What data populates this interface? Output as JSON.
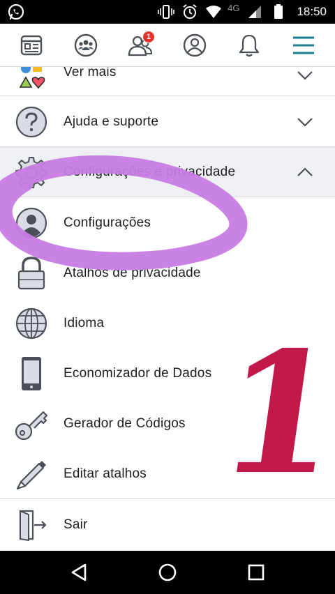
{
  "status_bar": {
    "network": "4G",
    "time": "18:50",
    "icons": [
      "whatsapp-icon",
      "vibrate-icon",
      "alarm-icon",
      "wifi-icon",
      "signal-icon",
      "battery-icon"
    ]
  },
  "nav": {
    "items": [
      {
        "name": "news-feed-icon"
      },
      {
        "name": "groups-icon"
      },
      {
        "name": "friend-requests-icon",
        "badge": "1"
      },
      {
        "name": "profile-icon"
      },
      {
        "name": "notifications-icon"
      },
      {
        "name": "menu-icon"
      }
    ],
    "accent": "#1877f2",
    "badge_color": "#e4332b"
  },
  "menu": {
    "items": [
      {
        "label": "Ver mais",
        "icon": "shapes-icon"
      },
      {
        "label": "Ajuda e suporte",
        "icon": "question-icon"
      },
      {
        "label": "Configurações e privacidade",
        "icon": "gear-icon"
      },
      {
        "label": "Configurações",
        "icon": "user-icon"
      },
      {
        "label": "Atalhos de privacidade",
        "icon": "lock-icon"
      },
      {
        "label": "Idioma",
        "icon": "globe-icon"
      },
      {
        "label": "Economizador de Dados",
        "icon": "phone-icon"
      },
      {
        "label": "Gerador de Códigos",
        "icon": "key-icon"
      },
      {
        "label": "Editar atalhos",
        "icon": "pencil-icon"
      },
      {
        "label": "Sair",
        "icon": "logout-icon"
      }
    ]
  },
  "annotation": {
    "number": "1",
    "number_color": "#c2184a",
    "circle_color": "#c77be3"
  },
  "android_nav": {
    "buttons": [
      "back-icon",
      "home-icon",
      "recents-icon"
    ]
  }
}
